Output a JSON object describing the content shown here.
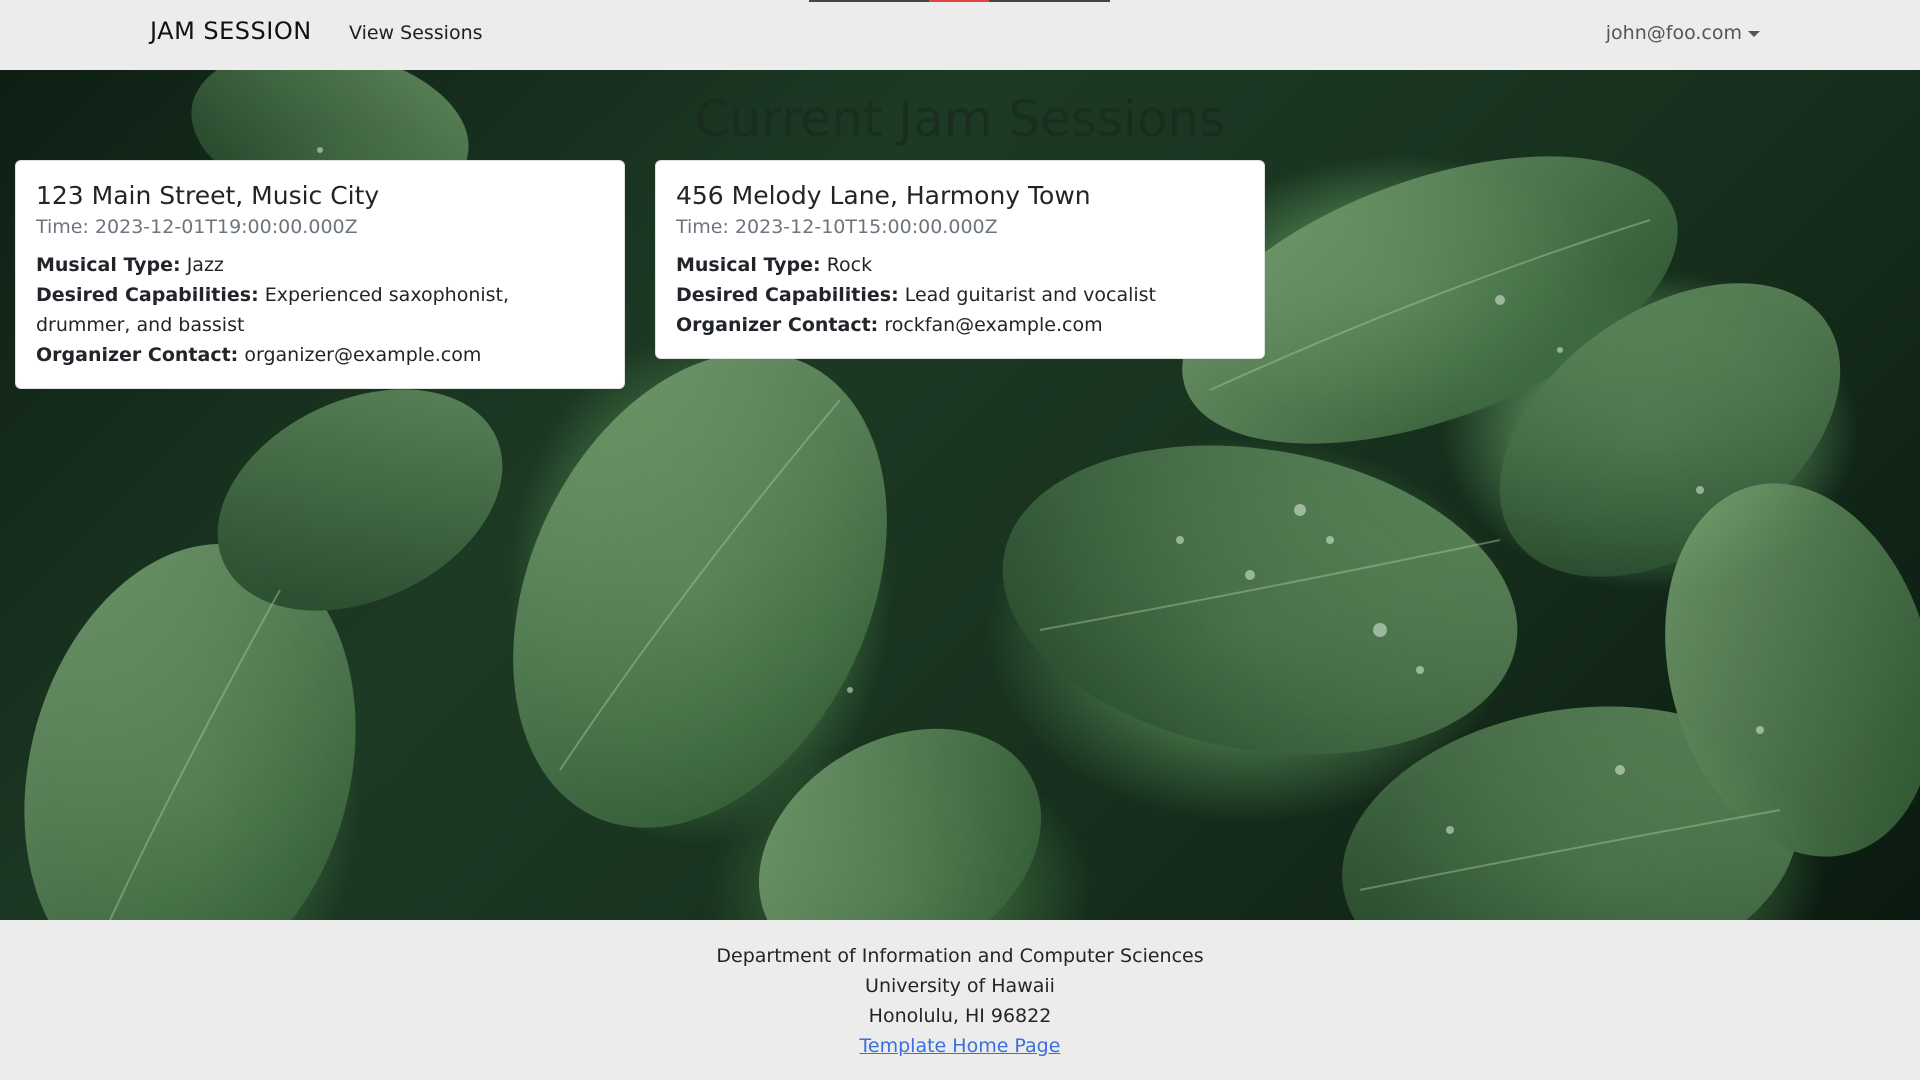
{
  "navbar": {
    "brand": "JAM SESSION",
    "nav_link": "View Sessions",
    "user_email": "john@foo.com"
  },
  "hero": {
    "title": "Current Jam Sessions"
  },
  "sessions": [
    {
      "location": "123 Main Street, Music City",
      "time_label": "Time:",
      "time": "2023-12-01T19:00:00.000Z",
      "musical_type_label": "Musical Type:",
      "musical_type": "Jazz",
      "capabilities_label": "Desired Capabilities:",
      "capabilities": "Experienced saxophonist, drummer, and bassist",
      "contact_label": "Organizer Contact:",
      "contact": "organizer@example.com"
    },
    {
      "location": "456 Melody Lane, Harmony Town",
      "time_label": "Time:",
      "time": "2023-12-10T15:00:00.000Z",
      "musical_type_label": "Musical Type:",
      "musical_type": "Rock",
      "capabilities_label": "Desired Capabilities:",
      "capabilities": "Lead guitarist and vocalist",
      "contact_label": "Organizer Contact:",
      "contact": "rockfan@example.com"
    }
  ],
  "footer": {
    "line1": "Department of Information and Computer Sciences",
    "line2": "University of Hawaii",
    "line3": "Honolulu, HI 96822",
    "link_text": "Template Home Page"
  },
  "colors": {
    "navbar_bg": "#ececec",
    "footer_link": "#3b6fd9",
    "indicator_active": "#e0463f"
  },
  "icons": {
    "user_menu": "caret-down-icon"
  }
}
